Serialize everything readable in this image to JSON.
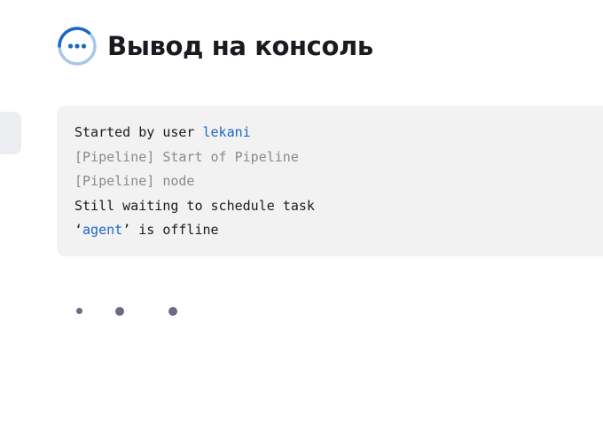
{
  "page": {
    "title": "Вывод на консоль",
    "status_icon": "in-progress-icon",
    "colors": {
      "accent": "#1b66c9",
      "icon_ring": "#a9c6ea",
      "console_bg": "#f2f2f2",
      "muted_text": "#8a8a90",
      "spinner_dot": "#6f6a84"
    }
  },
  "console": {
    "lines": [
      {
        "prefix": "Started by user ",
        "link": "lekani",
        "suffix": ""
      },
      {
        "text": "[Pipeline] Start of Pipeline"
      },
      {
        "text": "[Pipeline] node"
      },
      {
        "text": "Still waiting to schedule task"
      },
      {
        "prefix": "‘",
        "link": "agent",
        "suffix": "’ is offline"
      }
    ]
  },
  "loading": {
    "icon": "loading-dots-icon"
  }
}
